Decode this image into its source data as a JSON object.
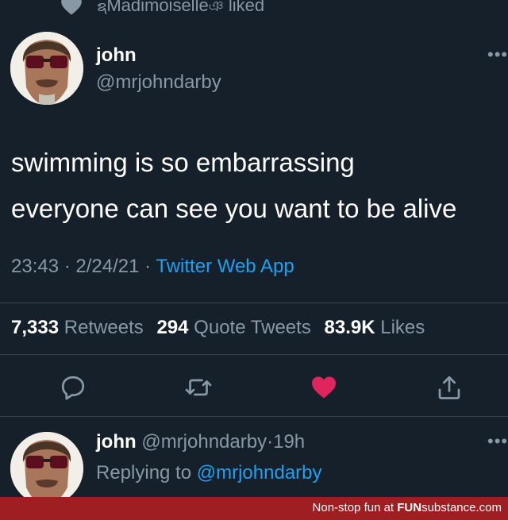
{
  "liked_header": {
    "user": "Madimoiselle",
    "action": "liked"
  },
  "tweet": {
    "name": "john",
    "handle": "@mrjohndarby",
    "text_lines": [
      "swimming is so embarrassing",
      "everyone can see you want to be alive"
    ],
    "time": "23:43",
    "date": "2/24/21",
    "source": "Twitter Web App",
    "separator": "·",
    "stats": {
      "retweets_count": "7,333",
      "retweets_label": "Retweets",
      "quotes_count": "294",
      "quotes_label": "Quote Tweets",
      "likes_count": "83.9K",
      "likes_label": "Likes"
    },
    "liked_color": "#e0245e"
  },
  "reply": {
    "name": "john",
    "handle": "@mrjohndarby",
    "age": "19h",
    "replying_prefix": "Replying to",
    "replying_to": "@mrjohndarby"
  },
  "footer": {
    "prefix": "Non-stop fun at",
    "brand_a": "FUN",
    "brand_b": "substance",
    "brand_c": ".com"
  },
  "icons": [
    "heart-icon",
    "more-icon",
    "reply-icon",
    "retweet-icon",
    "like-icon",
    "share-icon"
  ]
}
